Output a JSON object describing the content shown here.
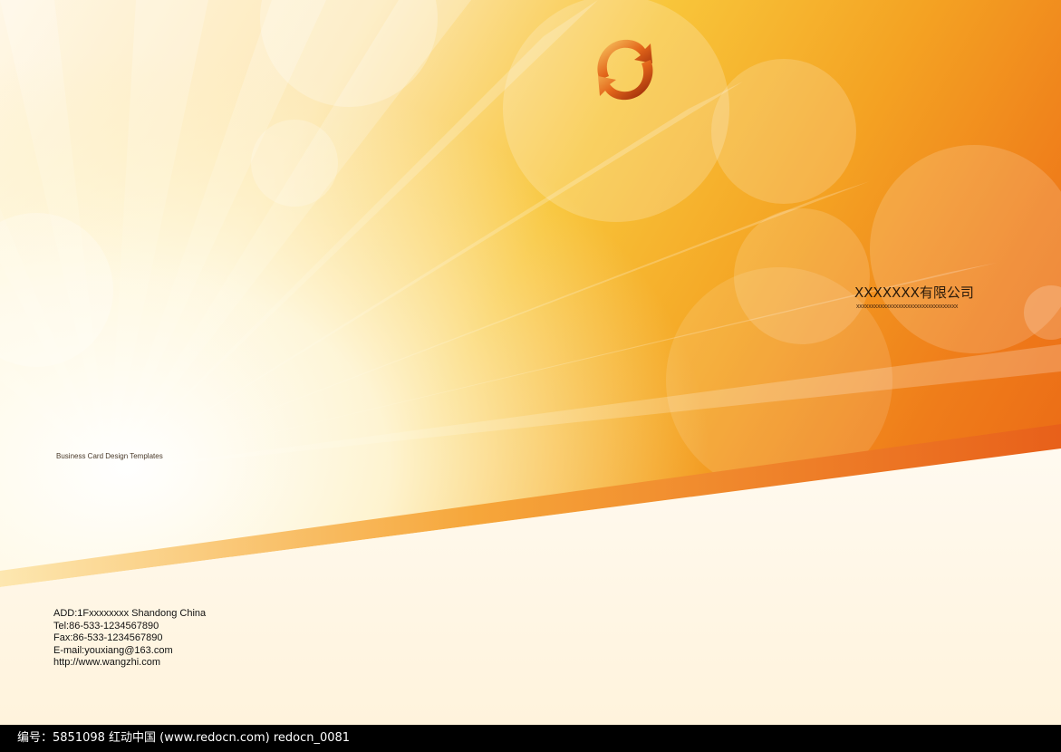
{
  "company": {
    "name": "XXXXXXX有限公司",
    "subtitle": "xxxxxxxxxxxxxxxxxxxxxxxxxxxxxxxxxx"
  },
  "card_label": "Business Card Design Templates",
  "contact": {
    "address": "ADD:1Fxxxxxxxx Shandong China",
    "tel": "Tel:86-533-1234567890",
    "fax": "Fax:86-533-1234567890",
    "email": "E-mail:youxiang@163.com",
    "web": "http://www.wangzhi.com"
  },
  "footer": {
    "text": "编号：5851098    红动中国 (www.redocn.com)    redocn_0081"
  },
  "icons": {
    "logo": "recycle-arrows-logo-icon"
  },
  "colors": {
    "orange_dark": "#e85a12",
    "orange": "#f4a323",
    "yellow": "#f8c53a",
    "cream": "#fff7e6",
    "footer_bg": "#000000"
  }
}
